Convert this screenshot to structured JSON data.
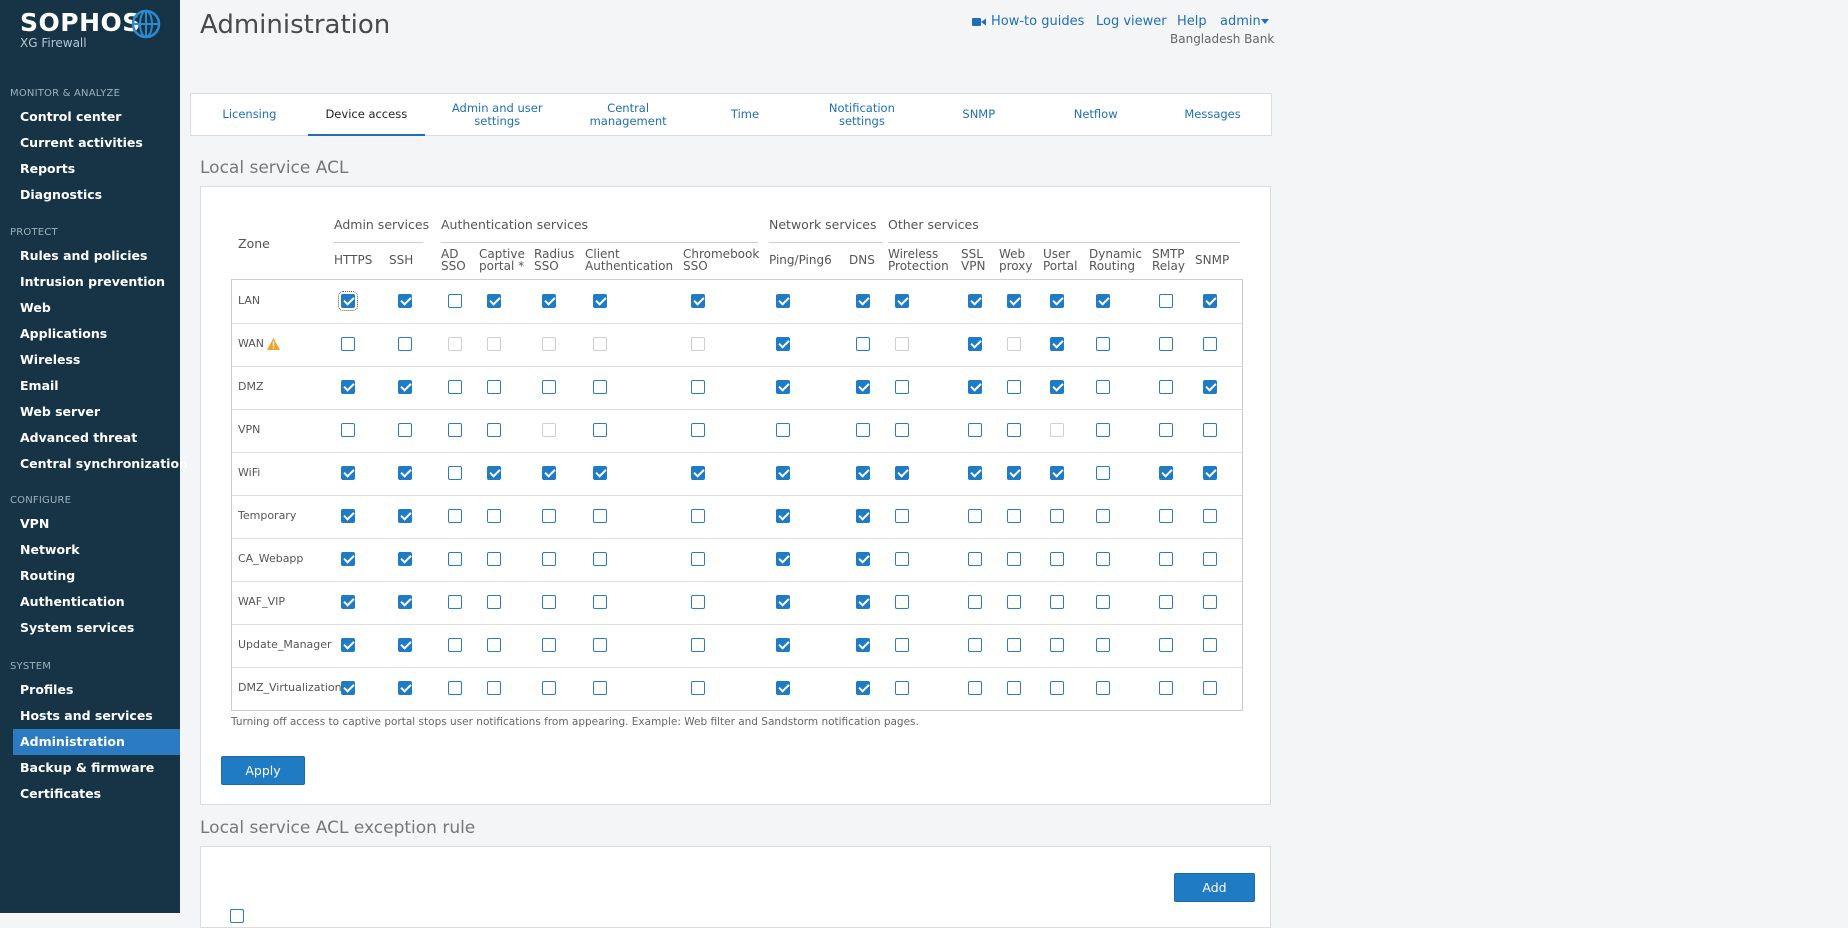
{
  "brand": {
    "name": "SOPHOS",
    "product": "XG Firewall"
  },
  "sidebar": {
    "sections": [
      {
        "heading": "MONITOR & ANALYZE",
        "items": [
          "Control center",
          "Current activities",
          "Reports",
          "Diagnostics"
        ]
      },
      {
        "heading": "PROTECT",
        "items": [
          "Rules and policies",
          "Intrusion prevention",
          "Web",
          "Applications",
          "Wireless",
          "Email",
          "Web server",
          "Advanced threat",
          "Central synchronization"
        ]
      },
      {
        "heading": "CONFIGURE",
        "items": [
          "VPN",
          "Network",
          "Routing",
          "Authentication",
          "System services"
        ]
      },
      {
        "heading": "SYSTEM",
        "items": [
          "Profiles",
          "Hosts and services",
          "Administration",
          "Backup & firmware",
          "Certificates"
        ]
      }
    ],
    "active": "Administration"
  },
  "header": {
    "title": "Administration",
    "links": {
      "howto": "How-to guides",
      "logviewer": "Log viewer",
      "help": "Help",
      "user": "admin"
    },
    "org": "Bangladesh Bank"
  },
  "tabs": [
    "Licensing",
    "Device access",
    "Admin and user settings",
    "Central management",
    "Time",
    "Notification settings",
    "SNMP",
    "Netflow",
    "Messages"
  ],
  "active_tab": "Device access",
  "acl": {
    "title": "Local service ACL",
    "zone_header": "Zone",
    "groups": [
      "Admin services",
      "Authentication services",
      "Network services",
      "Other services"
    ],
    "columns": [
      {
        "l1": "HTTPS",
        "l2": ""
      },
      {
        "l1": "SSH",
        "l2": ""
      },
      {
        "l1": "AD",
        "l2": "SSO"
      },
      {
        "l1": "Captive",
        "l2": "portal *"
      },
      {
        "l1": "Radius",
        "l2": "SSO"
      },
      {
        "l1": "Client",
        "l2": "Authentication"
      },
      {
        "l1": "Chromebook",
        "l2": "SSO"
      },
      {
        "l1": "Ping/Ping6",
        "l2": ""
      },
      {
        "l1": "DNS",
        "l2": ""
      },
      {
        "l1": "Wireless",
        "l2": "Protection"
      },
      {
        "l1": "SSL",
        "l2": "VPN"
      },
      {
        "l1": "Web",
        "l2": "proxy"
      },
      {
        "l1": "User",
        "l2": "Portal"
      },
      {
        "l1": "Dynamic",
        "l2": "Routing"
      },
      {
        "l1": "SMTP",
        "l2": "Relay"
      },
      {
        "l1": "SNMP",
        "l2": ""
      }
    ],
    "rows": [
      {
        "zone": "LAN",
        "states": "1101111111111101"
      },
      {
        "zone": "WAN",
        "states": "00ddddd10d1d1000",
        "warning": true
      },
      {
        "zone": "DMZ",
        "states": "1100000110101001"
      },
      {
        "zone": "VPN",
        "states": "0000d0000000d0001"
      },
      {
        "zone": "WiFi",
        "states": "1101111111111011"
      },
      {
        "zone": "Temporary",
        "states": "1100000110000000"
      },
      {
        "zone": "CA_Webapp",
        "states": "1100000110000000"
      },
      {
        "zone": "WAF_VIP",
        "states": "1100000110000000"
      },
      {
        "zone": "Update_Manager",
        "states": "1100000110000000"
      },
      {
        "zone": "DMZ_Virtualization",
        "states": "1100000110000000"
      }
    ],
    "note": "Turning off access to captive portal stops user notifications from appearing. Example: Web filter and Sandstorm notification pages.",
    "apply_label": "Apply"
  },
  "exception": {
    "title": "Local service ACL exception rule",
    "add_label": "Add"
  }
}
